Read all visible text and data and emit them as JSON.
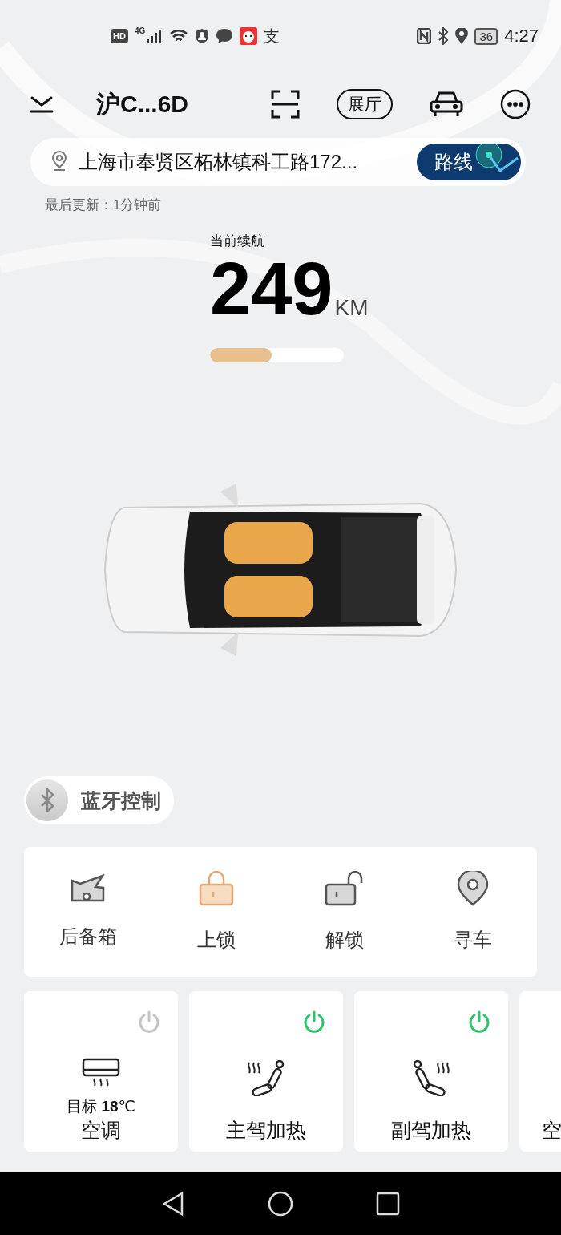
{
  "status_bar": {
    "hd_badge": "HD",
    "network": "4G",
    "app_glyph": "支",
    "battery": "36",
    "time": "4:27"
  },
  "header": {
    "title": "沪C...6D",
    "showroom_button": "展厅"
  },
  "location": {
    "address": "上海市奉贤区柘林镇科工路172...",
    "route_button": "路线",
    "updated": "最后更新：1分钟前"
  },
  "range": {
    "label": "当前续航",
    "value": "249",
    "unit": "KM",
    "level": 0.46
  },
  "bluetooth": {
    "label": "蓝牙控制",
    "connected": false
  },
  "actions": [
    {
      "kind": "trunk",
      "label": "后备箱",
      "active": false
    },
    {
      "kind": "lock",
      "label": "上锁",
      "active": true
    },
    {
      "kind": "unlock",
      "label": "解锁",
      "active": false
    },
    {
      "kind": "find",
      "label": "寻车",
      "active": false
    }
  ],
  "controls": [
    {
      "kind": "climate",
      "on": false,
      "target_label": "目标",
      "target_value": "18",
      "target_unit": "℃",
      "label": "空调"
    },
    {
      "kind": "seat-driver",
      "on": true,
      "label": "主驾加热"
    },
    {
      "kind": "seat-passenger",
      "on": true,
      "label": "副驾加热"
    },
    {
      "kind": "partial",
      "label": "空"
    }
  ]
}
